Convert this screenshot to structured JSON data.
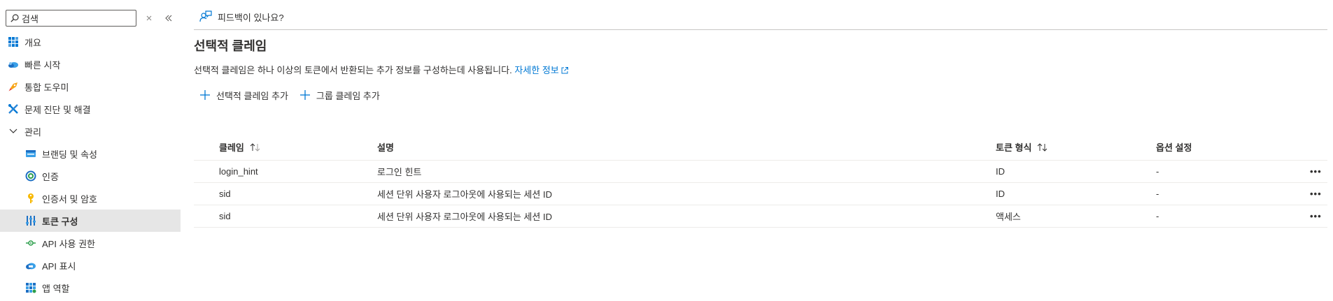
{
  "search": {
    "placeholder": "검색",
    "value": "검색"
  },
  "sidebar": {
    "items": [
      {
        "label": "개요",
        "icon": "overview-grid-icon"
      },
      {
        "label": "빠른 시작",
        "icon": "quickstart-cloud-icon"
      },
      {
        "label": "통합 도우미",
        "icon": "rocket-icon"
      },
      {
        "label": "문제 진단 및 해결",
        "icon": "tools-icon"
      },
      {
        "label": "관리",
        "icon": "chevron-down-icon"
      },
      {
        "label": "브랜딩 및 속성",
        "icon": "branding-icon"
      },
      {
        "label": "인증",
        "icon": "authentication-icon"
      },
      {
        "label": "인증서 및 암호",
        "icon": "key-icon"
      },
      {
        "label": "토큰 구성",
        "icon": "token-config-icon"
      },
      {
        "label": "API 사용 권한",
        "icon": "api-permissions-icon"
      },
      {
        "label": "API 표시",
        "icon": "expose-api-icon"
      },
      {
        "label": "앱 역할",
        "icon": "app-roles-icon"
      }
    ]
  },
  "header": {
    "feedback_label": "피드백이 있나요?"
  },
  "main": {
    "title": "선택적 클레임",
    "description": "선택적 클레임은 하나 이상의 토큰에서 반환되는 추가 정보를 구성하는데 사용됩니다.",
    "learn_more": "자세한 정보",
    "commands": {
      "add_optional": "선택적 클레임 추가",
      "add_group": "그룹 클레임 추가"
    }
  },
  "table": {
    "columns": {
      "claim": "클레임",
      "description": "설명",
      "token_type": "토큰 형식",
      "options": "옵션 설정"
    },
    "rows": [
      {
        "claim": "login_hint",
        "description": "로그인 힌트",
        "token_type": "ID",
        "options": "-",
        "more": "•••"
      },
      {
        "claim": "sid",
        "description": "세션 단위 사용자 로그아웃에 사용되는 세션 ID",
        "token_type": "ID",
        "options": "-",
        "more": "•••"
      },
      {
        "claim": "sid",
        "description": "세션 단위 사용자 로그아웃에 사용되는 세션 ID",
        "token_type": "액세스",
        "options": "-",
        "more": "•••"
      }
    ]
  },
  "colors": {
    "accent": "#0078d4",
    "selected_bg": "#e6e6e6",
    "text": "#323130"
  }
}
